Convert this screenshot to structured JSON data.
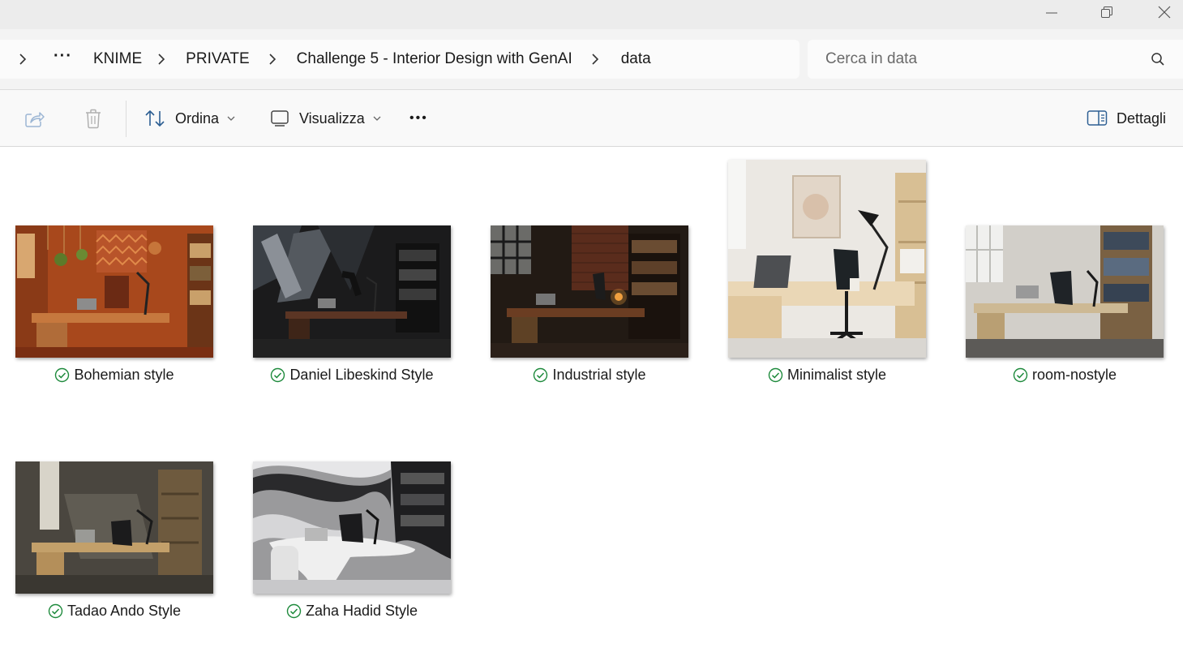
{
  "window": {
    "minimize_icon": "minimize-icon",
    "maximize_icon": "restore-icon",
    "close_icon": "close-icon"
  },
  "breadcrumb": {
    "items": [
      "KNIME",
      "PRIVATE",
      "Challenge 5 - Interior Design with GenAI",
      "data"
    ],
    "overflow": "···"
  },
  "search": {
    "placeholder": "Cerca in data"
  },
  "toolbar": {
    "sort_label": "Ordina",
    "view_label": "Visualizza",
    "more_label": "•••",
    "details_label": "Dettagli"
  },
  "colors": {
    "sync_check": "#1e8a3c",
    "accent": "#0067c0"
  },
  "files": [
    {
      "name": "Bohemian style",
      "status": "synced"
    },
    {
      "name": "Daniel Libeskind Style",
      "status": "synced"
    },
    {
      "name": "Industrial style",
      "status": "synced"
    },
    {
      "name": "Minimalist style",
      "status": "synced"
    },
    {
      "name": "room-nostyle",
      "status": "synced"
    },
    {
      "name": "Tadao Ando Style",
      "status": "synced"
    },
    {
      "name": "Zaha Hadid Style",
      "status": "synced"
    }
  ]
}
